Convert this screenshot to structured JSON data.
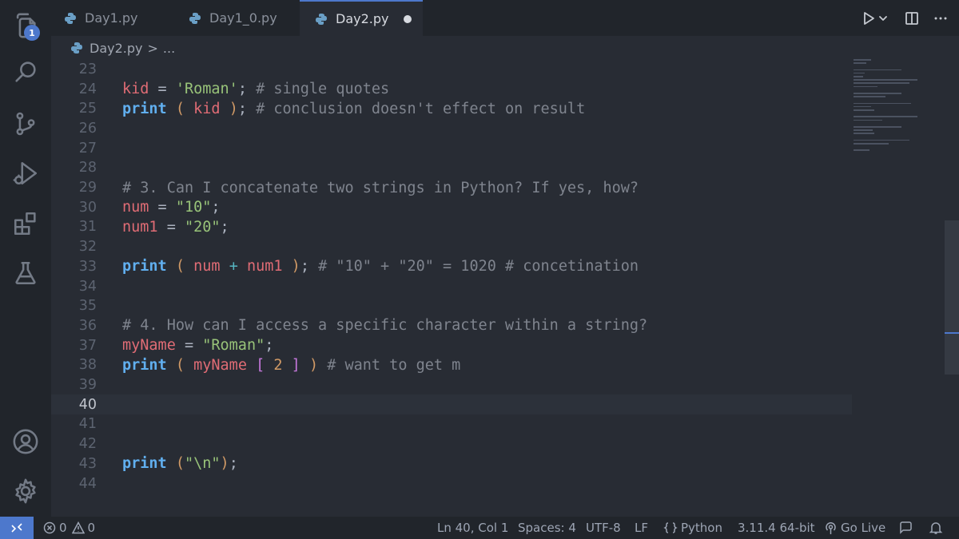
{
  "activity_bar": {
    "explorer_badge": "1",
    "icons": [
      "files-icon",
      "search-icon",
      "source-control-icon",
      "run-debug-icon",
      "extensions-icon",
      "testing-icon",
      "account-icon",
      "settings-gear-icon"
    ]
  },
  "tabs": [
    {
      "label": "Day1.py",
      "active": false
    },
    {
      "label": "Day1_0.py",
      "active": false
    },
    {
      "label": "Day2.py",
      "active": true,
      "dirty": true
    }
  ],
  "breadcrumb": {
    "file": "Day2.py",
    "separator": ">",
    "rest": "..."
  },
  "editor": {
    "current_line": 40,
    "lines": [
      {
        "n": "23",
        "tokens": []
      },
      {
        "n": "24",
        "tokens": [
          [
            "var",
            "kid"
          ],
          [
            "plain",
            " = "
          ],
          [
            "str",
            "'Roman'"
          ],
          [
            "plain",
            "; "
          ],
          [
            "com",
            "# single quotes"
          ]
        ]
      },
      {
        "n": "25",
        "tokens": [
          [
            "kw",
            "print"
          ],
          [
            "plain",
            " "
          ],
          [
            "paren",
            "("
          ],
          [
            "plain",
            " "
          ],
          [
            "var",
            "kid"
          ],
          [
            "plain",
            " "
          ],
          [
            "paren",
            ")"
          ],
          [
            "plain",
            "; "
          ],
          [
            "com",
            "# conclusion doesn't effect on result"
          ]
        ]
      },
      {
        "n": "26",
        "tokens": []
      },
      {
        "n": "27",
        "tokens": []
      },
      {
        "n": "28",
        "tokens": []
      },
      {
        "n": "29",
        "tokens": [
          [
            "com",
            "# 3. Can I concatenate two strings in Python? If yes, how?"
          ]
        ]
      },
      {
        "n": "30",
        "tokens": [
          [
            "var",
            "num"
          ],
          [
            "plain",
            " = "
          ],
          [
            "str",
            "\"10\""
          ],
          [
            "plain",
            ";"
          ]
        ]
      },
      {
        "n": "31",
        "tokens": [
          [
            "var",
            "num1"
          ],
          [
            "plain",
            " = "
          ],
          [
            "str",
            "\"20\""
          ],
          [
            "plain",
            ";"
          ]
        ]
      },
      {
        "n": "32",
        "tokens": []
      },
      {
        "n": "33",
        "tokens": [
          [
            "kw",
            "print"
          ],
          [
            "plain",
            " "
          ],
          [
            "paren",
            "("
          ],
          [
            "plain",
            " "
          ],
          [
            "var",
            "num"
          ],
          [
            "plain",
            " "
          ],
          [
            "op",
            "+"
          ],
          [
            "plain",
            " "
          ],
          [
            "var",
            "num1"
          ],
          [
            "plain",
            " "
          ],
          [
            "paren",
            ")"
          ],
          [
            "plain",
            "; "
          ],
          [
            "com",
            "# \"10\" + \"20\" = 1020 # concetination"
          ]
        ]
      },
      {
        "n": "34",
        "tokens": []
      },
      {
        "n": "35",
        "tokens": []
      },
      {
        "n": "36",
        "tokens": [
          [
            "com",
            "# 4. How can I access a specific character within a string?"
          ]
        ]
      },
      {
        "n": "37",
        "tokens": [
          [
            "var",
            "myName"
          ],
          [
            "plain",
            " = "
          ],
          [
            "str",
            "\"Roman\""
          ],
          [
            "plain",
            ";"
          ]
        ]
      },
      {
        "n": "38",
        "tokens": [
          [
            "kw",
            "print"
          ],
          [
            "plain",
            " "
          ],
          [
            "paren",
            "("
          ],
          [
            "plain",
            " "
          ],
          [
            "var",
            "myName"
          ],
          [
            "plain",
            " "
          ],
          [
            "brak",
            "["
          ],
          [
            "plain",
            " "
          ],
          [
            "num",
            "2"
          ],
          [
            "plain",
            " "
          ],
          [
            "brak",
            "]"
          ],
          [
            "plain",
            " "
          ],
          [
            "paren",
            ")"
          ],
          [
            "plain",
            " "
          ],
          [
            "com",
            "# want to get m"
          ]
        ]
      },
      {
        "n": "39",
        "tokens": []
      },
      {
        "n": "40",
        "tokens": []
      },
      {
        "n": "41",
        "tokens": []
      },
      {
        "n": "42",
        "tokens": []
      },
      {
        "n": "43",
        "tokens": [
          [
            "kw",
            "print"
          ],
          [
            "plain",
            " "
          ],
          [
            "paren",
            "("
          ],
          [
            "str",
            "\"\\n\""
          ],
          [
            "paren",
            ")"
          ],
          [
            "plain",
            ";"
          ]
        ]
      },
      {
        "n": "44",
        "tokens": []
      }
    ]
  },
  "statusbar": {
    "errors": "0",
    "warnings": "0",
    "cursor": "Ln 40, Col 1",
    "spaces": "Spaces: 4",
    "encoding": "UTF-8",
    "eol": "LF",
    "language": "Python",
    "interpreter": "3.11.4 64-bit",
    "go_live": "Go Live"
  },
  "colors": {
    "accent": "#4d78cc",
    "editor_bg": "#282c34",
    "chrome_bg": "#21252b"
  }
}
